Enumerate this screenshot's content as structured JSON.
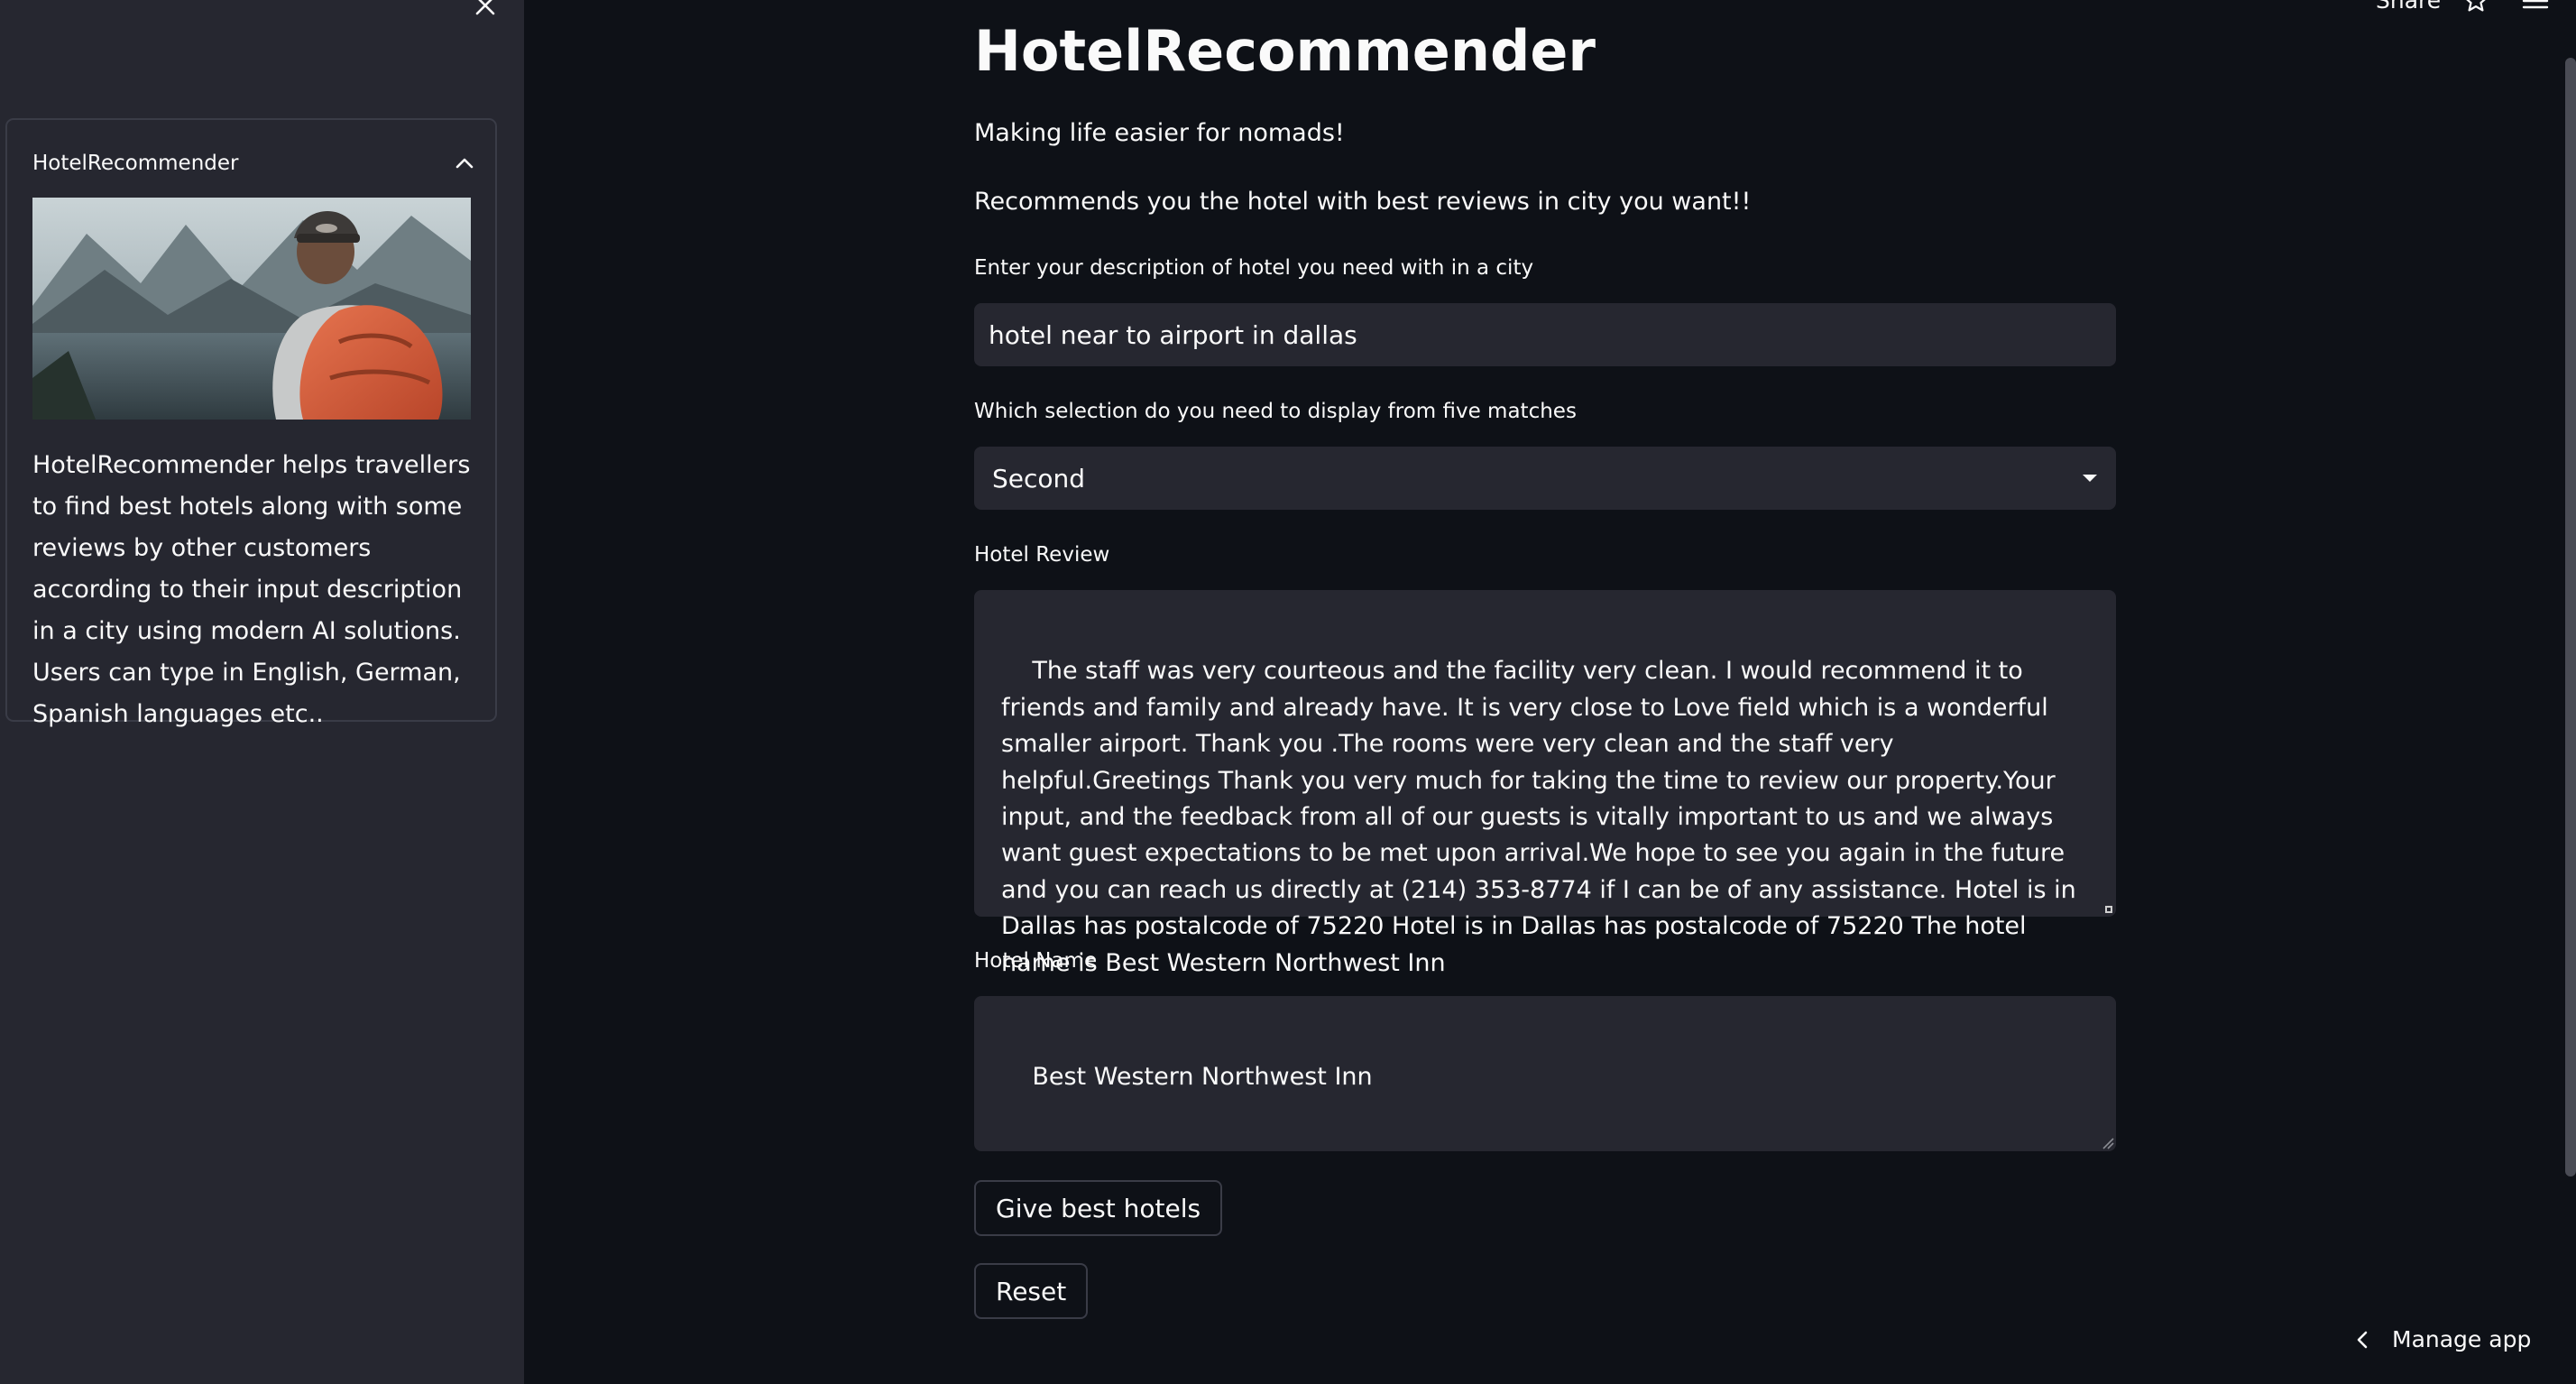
{
  "header": {
    "share_label": "Share"
  },
  "sidebar": {
    "expander": {
      "title": "HotelRecommender",
      "description": "HotelRecommender helps travellers to find best hotels along with some reviews by other customers according to their input description in a city using modern AI solutions. Users can type in English, German, Spanish languages etc.."
    }
  },
  "main": {
    "title": "HotelRecommender",
    "subtitle": "Making life easier for nomads!",
    "tagline": "Recommends you the hotel with best reviews in city you want!!",
    "description_input": {
      "label": "Enter your description of hotel you need with in a city",
      "value": "hotel near to airport in dallas"
    },
    "selection": {
      "label": "Which selection do you need to display from five matches",
      "value": "Second"
    },
    "review": {
      "label": "Hotel Review",
      "value": "The staff was very courteous and the facility very clean. I would recommend it to friends and family and already have. It is very close to Love field which is a wonderful smaller airport. Thank you .The rooms were very clean and the staff very helpful.Greetings Thank you very much for taking the time to review our property.Your input, and the feedback from all of our guests is vitally important to us and we always want guest expectations to be met upon arrival.We hope to see you again in the future and you can reach us directly at (214) 353-8774 if I can be of any assistance. Hotel is in Dallas has postalcode of 75220 Hotel is in Dallas has postalcode of 75220 The hotel name is Best Western Northwest Inn"
    },
    "hotel_name": {
      "label": "Hotel Name",
      "value": "Best Western Northwest Inn"
    },
    "buttons": {
      "give_label": "Give best hotels",
      "reset_label": "Reset"
    }
  },
  "footer": {
    "manage_label": "Manage app"
  },
  "icons": {
    "close": "close-icon",
    "collapse": "chevron-up-icon",
    "dropdown": "caret-down-icon",
    "star": "star-icon",
    "menu": "hamburger-menu-icon",
    "manage": "chevron-left-icon"
  },
  "colors": {
    "background": "#0e1117",
    "sidebar": "#262730",
    "widget": "#262730",
    "text": "#fafafa"
  }
}
